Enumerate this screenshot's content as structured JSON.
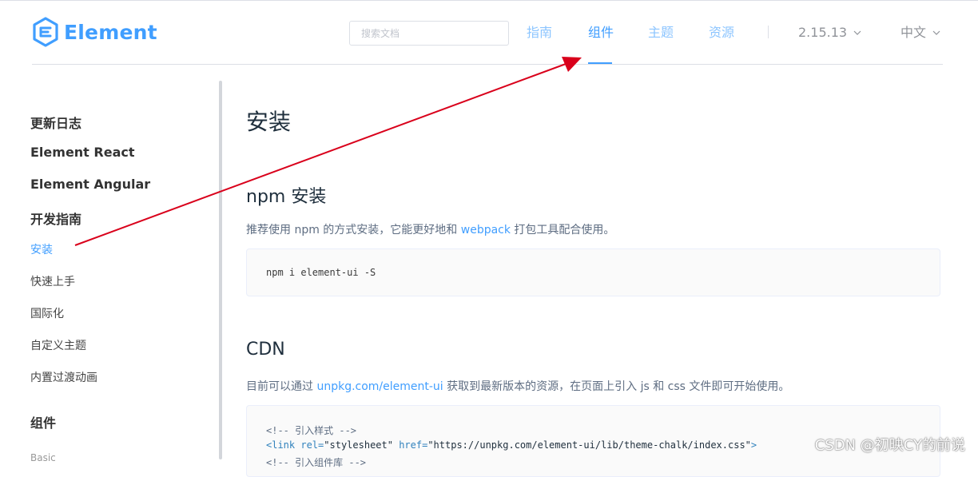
{
  "header": {
    "logo_text": "Element",
    "search_placeholder": "搜索文档",
    "nav": [
      {
        "label": "指南",
        "active": false
      },
      {
        "label": "组件",
        "active": true
      },
      {
        "label": "主题",
        "active": false
      },
      {
        "label": "资源",
        "active": false
      }
    ],
    "version": "2.15.13",
    "language": "中文"
  },
  "sidebar": {
    "items": [
      {
        "label": "更新日志",
        "kind": "group"
      },
      {
        "label": "Element React",
        "kind": "group"
      },
      {
        "label": "Element Angular",
        "kind": "group"
      },
      {
        "label": "开发指南",
        "kind": "group"
      },
      {
        "label": "安装",
        "kind": "link",
        "active": true
      },
      {
        "label": "快速上手",
        "kind": "link"
      },
      {
        "label": "国际化",
        "kind": "link"
      },
      {
        "label": "自定义主题",
        "kind": "link"
      },
      {
        "label": "内置过渡动画",
        "kind": "link"
      },
      {
        "label": "组件",
        "kind": "group"
      },
      {
        "label": "Basic",
        "kind": "sub"
      }
    ]
  },
  "main": {
    "title": "安装",
    "npm_section": {
      "heading": "npm 安装",
      "text_before": "推荐使用 npm 的方式安装，它能更好地和 ",
      "link": "webpack",
      "text_after": " 打包工具配合使用。",
      "code": "npm i element-ui -S"
    },
    "cdn_section": {
      "heading": "CDN",
      "text_before": "目前可以通过 ",
      "link": "unpkg.com/element-ui",
      "text_after": " 获取到最新版本的资源，在页面上引入 js 和 css 文件即可开始使用。",
      "code_comment": "<!-- 引入样式 -->",
      "code_tag_open": "<link",
      "code_attr_rel": "rel=",
      "code_val_rel": "\"stylesheet\"",
      "code_attr_href": "href=",
      "code_val_href": "\"https://unpkg.com/element-ui/lib/theme-chalk/index.css\"",
      "code_tag_close": ">",
      "code_comment2": "<!-- 引入组件库 -->"
    }
  },
  "watermark": "CSDN @初映CY的前说",
  "colors": {
    "brand": "#409eff",
    "nav_inactive": "#8cc5ff",
    "annotation_arrow": "#d9001b"
  }
}
